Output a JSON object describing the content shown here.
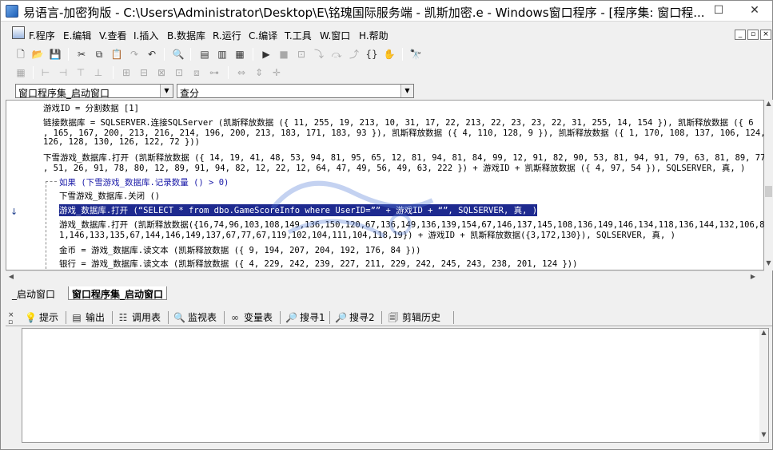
{
  "window": {
    "title": "易语言-加密狗版 - C:\\Users\\Administrator\\Desktop\\E\\铭瑰国际服务端 - 凯斯加密.e - Windows窗口程序 - [程序集: 窗口程...",
    "min": "—",
    "max": "☐",
    "close": "✕"
  },
  "menu": {
    "items": [
      "F.程序",
      "E.编辑",
      "V.查看",
      "I.插入",
      "B.数据库",
      "R.运行",
      "C.编译",
      "T.工具",
      "W.窗口",
      "H.帮助"
    ],
    "mdi": [
      "_",
      "▫",
      "×"
    ]
  },
  "combos": {
    "left": "窗口程序集_启动窗口",
    "right": "查分"
  },
  "code": {
    "line1": "游戏ID = 分割数据 [1]",
    "line2": "链接数据库 = SQLSERVER.连接SQLServer (凯斯释放数据 ({ 11, 255, 19, 213, 10, 31, 17, 22, 213, 22, 23, 23, 22, 31, 255, 14, 154 }), 凯斯释放数据 ({ 6",
    "line3": ", 165, 167, 200, 213, 216, 214, 196, 200, 213, 183, 171, 183, 93 }), 凯斯释放数据 ({ 4, 110, 128, 9 }), 凯斯释放数据 ({ 1, 170, 108, 137, 106, 124,",
    "line4": "126, 128, 130, 126, 122, 72 }))",
    "line5": "下雪游戏_数据库.打开 (凯斯释放数据 ({ 14, 19, 41, 48, 53, 94, 81, 95, 65, 12, 81, 94, 81, 84, 99, 12, 91, 82, 90, 53, 81, 94, 91, 79, 63, 81, 89, 77",
    "line6": ", 51, 26, 91, 78, 80, 12, 89, 91, 94, 82, 12, 22, 12, 64, 47, 49, 56, 49, 63, 222 }) + 游戏ID + 凯斯释放数据 ({ 4, 97, 54 }), SQLSERVER, 真, )",
    "line7": "如果 (下雪游戏_数据库.记录数量 () > 0)",
    "line8": "下雪游戏_数据库.关闭 ()",
    "line9": "游戏_数据库.打开 (“SELECT * from dbo.GameScoreInfo where UserID=”” + 游戏ID + “”, SQLSERVER, 真, )",
    "line10": "游戏_数据库.打开 (凯斯释放数据({16,74,96,103,108,149,136,150,120,67,136,149,136,139,154,67,146,137,145,108,136,149,146,134,118,136,144,132,106,8",
    "line11": "1,146,133,135,67,144,146,149,137,67,77,67,119,102,104,111,104,118,19}) + 游戏ID + 凯斯释放数据({3,172,130}), SQLSERVER, 真, )",
    "line12": "金币 = 游戏_数据库.读文本 (凯斯释放数据 ({ 9, 194, 207, 204, 192, 176, 84 }))",
    "line13": "银行 = 游戏_数据库.读文本 (凯斯释放数据 ({ 4, 229, 242, 239, 227, 211, 229, 242, 245, 243, 238, 201, 124 }))"
  },
  "doc_tabs": [
    "_启动窗口",
    "窗口程序集_启动窗口"
  ],
  "bottom_tabs": [
    "提示",
    "输出",
    "调用表",
    "监视表",
    "变量表",
    "搜寻1",
    "搜寻2",
    "剪辑历史"
  ],
  "colors": {
    "highlight": "#1e2a8f",
    "editor_bg": "#ffffff",
    "window_bg": "#f0f0f0"
  }
}
